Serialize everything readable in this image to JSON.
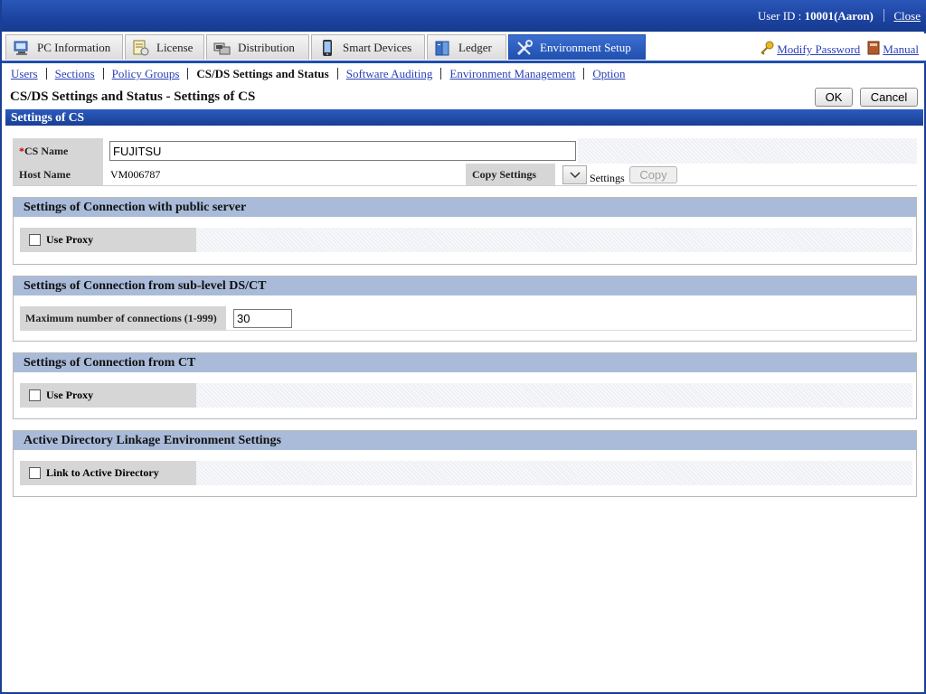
{
  "header": {
    "user_id_label": "User ID :",
    "user_id_value": "10001(Aaron)",
    "close_label": "Close"
  },
  "tabs": [
    {
      "label": "PC Information",
      "icon": "pc-info-icon"
    },
    {
      "label": "License",
      "icon": "license-icon"
    },
    {
      "label": "Distribution",
      "icon": "distribution-icon"
    },
    {
      "label": "Smart Devices",
      "icon": "smart-device-icon"
    },
    {
      "label": "Ledger",
      "icon": "ledger-icon"
    },
    {
      "label": "Environment Setup",
      "icon": "tools-icon",
      "active": true
    }
  ],
  "top_links": {
    "modify_password": "Modify Password",
    "manual": "Manual"
  },
  "subnav": {
    "users": "Users",
    "sections": "Sections",
    "policy_groups": "Policy Groups",
    "current": "CS/DS Settings and Status",
    "software_auditing": "Software Auditing",
    "environment_management": "Environment Management",
    "option": "Option"
  },
  "page": {
    "title": "CS/DS Settings and Status - Settings of CS",
    "ok_label": "OK",
    "cancel_label": "Cancel",
    "section_title": "Settings of CS"
  },
  "cs": {
    "required_mark": "*",
    "cs_name_label": "CS Name",
    "cs_name_value": "FUJITSU",
    "host_name_label": "Host Name",
    "host_name_value": "VM006787",
    "copy_settings_label": "Copy Settings",
    "settings_suffix": "Settings",
    "copy_button": "Copy"
  },
  "groups": {
    "public_server": {
      "title": "Settings of Connection with public server",
      "checkbox_label": "Use Proxy",
      "checked": false
    },
    "sub_level": {
      "title": "Settings of Connection from sub-level DS/CT",
      "max_conn_label": "Maximum number of connections (1-999)",
      "max_conn_value": "30"
    },
    "from_ct": {
      "title": "Settings of Connection from CT",
      "checkbox_label": "Use Proxy",
      "checked": false
    },
    "active_directory": {
      "title": "Active Directory Linkage Environment Settings",
      "checkbox_label": "Link to Active Directory",
      "checked": false
    }
  },
  "colors": {
    "header_blue": "#1c43a0",
    "active_tab": "#1f4faf",
    "group_header": "#a9bbd9",
    "label_gray": "#d6d6d6",
    "link": "#2a40b8",
    "required": "#cc0000"
  }
}
